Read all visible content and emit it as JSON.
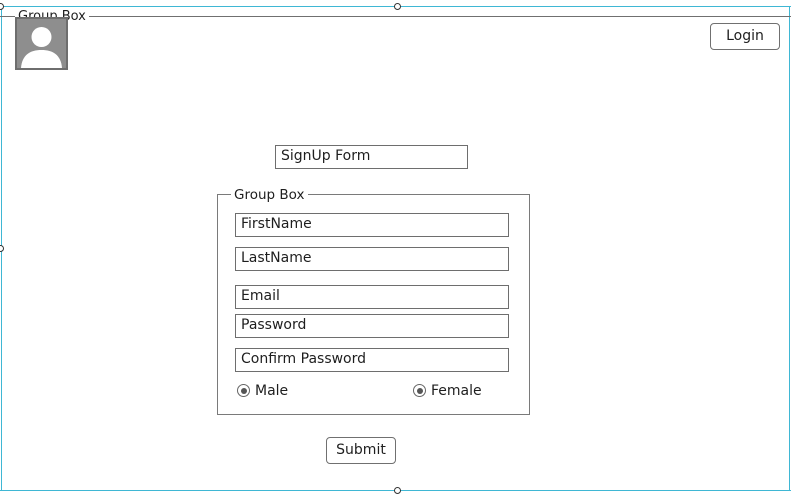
{
  "outer_group": {
    "header": "Group Box"
  },
  "login_button": {
    "label": "Login"
  },
  "title_box": {
    "value": "SignUp Form"
  },
  "inner_group": {
    "header": "Group Box"
  },
  "fields": {
    "first_name": "FirstName",
    "last_name": "LastName",
    "email": "Email",
    "password": "Password",
    "confirm_password": "Confirm Password"
  },
  "gender": {
    "male": "Male",
    "female": "Female"
  },
  "submit_button": {
    "label": "Submit"
  },
  "icons": {
    "avatar": "user-silhouette-icon"
  },
  "colors": {
    "selection_frame": "#3fb7d4",
    "avatar_bg": "#8e8e8e"
  }
}
